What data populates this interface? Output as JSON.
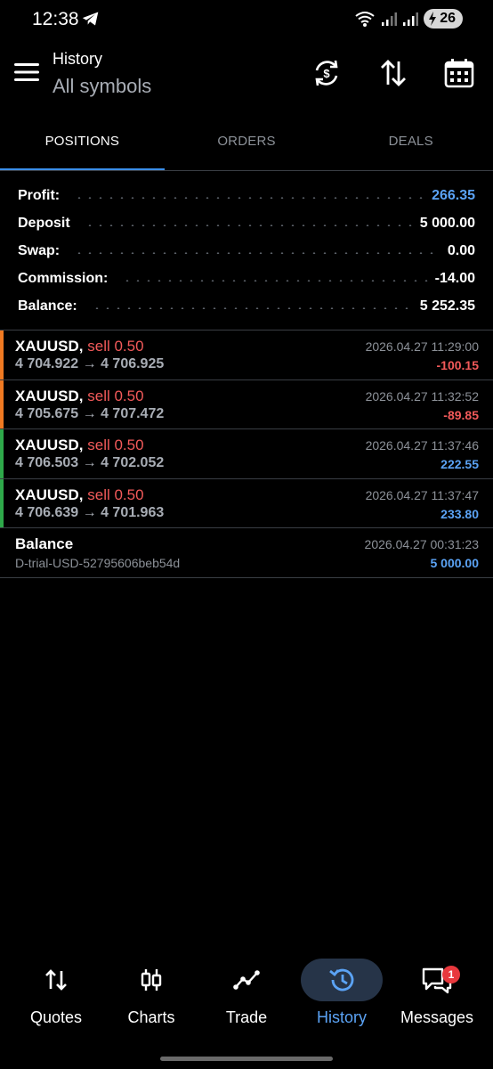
{
  "status_bar": {
    "time": "12:38",
    "battery": "26",
    "icons": [
      "telegram-icon",
      "wifi-icon",
      "signal-icon",
      "signal-icon",
      "battery-charging-icon"
    ]
  },
  "header": {
    "title": "History",
    "subtitle": "All symbols",
    "actions": [
      "currency-exchange-icon",
      "sort-icon",
      "calendar-icon"
    ]
  },
  "tabs": [
    {
      "label": "POSITIONS",
      "active": true
    },
    {
      "label": "ORDERS",
      "active": false
    },
    {
      "label": "DEALS",
      "active": false
    }
  ],
  "summary": [
    {
      "label": "Profit:",
      "value": "266.35",
      "color": "#5ba3f5"
    },
    {
      "label": "Deposit",
      "value": "5 000.00"
    },
    {
      "label": "Swap:",
      "value": "0.00"
    },
    {
      "label": "Commission:",
      "value": "-14.00"
    },
    {
      "label": "Balance:",
      "value": "5 252.35"
    }
  ],
  "positions": [
    {
      "symbol": "XAUUSD,",
      "side": "sell 0.50",
      "prices": "4 704.922 → 4 706.925",
      "date": "2026.04.27 11:29:00",
      "profit": "-100.15",
      "bar_color": "#f07a22"
    },
    {
      "symbol": "XAUUSD,",
      "side": "sell 0.50",
      "prices": "4 705.675 → 4 707.472",
      "date": "2026.04.27 11:32:52",
      "profit": "-89.85",
      "bar_color": "#f07a22"
    },
    {
      "symbol": "XAUUSD,",
      "side": "sell 0.50",
      "prices": "4 706.503 → 4 702.052",
      "date": "2026.04.27 11:37:46",
      "profit": "222.55",
      "bar_color": "#2ea84a"
    },
    {
      "symbol": "XAUUSD,",
      "side": "sell 0.50",
      "prices": "4 706.639 → 4 701.963",
      "date": "2026.04.27 11:37:47",
      "profit": "233.80",
      "bar_color": "#2ea84a"
    }
  ],
  "balance_item": {
    "title": "Balance",
    "desc": "D-trial-USD-52795606beb54d",
    "date": "2026.04.27 00:31:23",
    "amount": "5 000.00"
  },
  "bottom_nav": [
    {
      "label": "Quotes",
      "icon": "quotes-arrows-icon",
      "active": false
    },
    {
      "label": "Charts",
      "icon": "candlestick-icon",
      "active": false
    },
    {
      "label": "Trade",
      "icon": "trade-line-icon",
      "active": false
    },
    {
      "label": "History",
      "icon": "history-icon",
      "active": true
    },
    {
      "label": "Messages",
      "icon": "messages-icon",
      "active": false,
      "badge": "1"
    }
  ],
  "colors": {
    "accent": "#3b8ee8",
    "positive": "#5ba3f5",
    "negative": "#f25a5a",
    "loss_bar": "#f07a22",
    "gain_bar": "#2ea84a"
  }
}
